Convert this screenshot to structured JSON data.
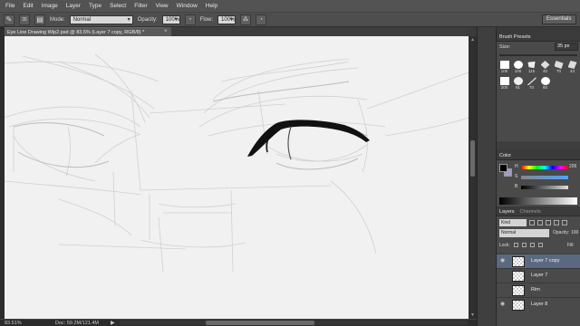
{
  "menubar": {
    "items": [
      "File",
      "Edit",
      "Image",
      "Layer",
      "Type",
      "Select",
      "Filter",
      "View",
      "Window",
      "Help"
    ]
  },
  "options": {
    "brush_size": "35",
    "mode_label": "Mode:",
    "mode_value": "Normal",
    "opacity_label": "Opacity:",
    "opacity_value": "100%",
    "flow_label": "Flow:",
    "flow_value": "100%",
    "workspace": "Essentials"
  },
  "document": {
    "tab_title": "Eye Line Drawing Wip2.psd @ 83.5% (Layer 7 copy, RGB/8) *",
    "close_glyph": "×"
  },
  "status": {
    "zoom": "83.51%",
    "doc_size": "Doc: 59.2M/121.4M",
    "arrow": "▶"
  },
  "brush_presets": {
    "tab": "Brush Presets",
    "size_label": "Size:",
    "size_value": "35 px",
    "tips": [
      {
        "num": "100",
        "color": "#ffffff"
      },
      {
        "num": "100",
        "color": "#ffffff"
      },
      {
        "num": "116",
        "color": "#eeeeee"
      },
      {
        "num": "40",
        "color": "#dddddd"
      },
      {
        "num": "70",
        "color": "#dddddd"
      },
      {
        "num": "44",
        "color": "#dddddd"
      },
      {
        "num": "200",
        "color": "#ffffff"
      },
      {
        "num": "91",
        "color": "#eeeeee"
      },
      {
        "num": "70",
        "color": "#dddddd"
      },
      {
        "num": "60",
        "color": "#ffffff"
      }
    ]
  },
  "color_panel": {
    "tab": "Color",
    "h_label": "H",
    "h_value": "206",
    "s_label": "S",
    "b_label": "B",
    "fg_color": "#000000",
    "bg_color": "#a39bc9"
  },
  "layers_panel": {
    "tabs": [
      "Layers",
      "Channels"
    ],
    "kind": "Kind",
    "blend_mode": "Normal",
    "opacity_label": "Opacity:",
    "opacity_value": "100",
    "lock_label": "Lock:",
    "fill_label": "Fill:",
    "fill_value": "100",
    "layers": [
      {
        "name": "Layer 7 copy",
        "visible": true,
        "active": true
      },
      {
        "name": "Layer 7",
        "visible": false,
        "active": false
      },
      {
        "name": "Rim",
        "visible": false,
        "active": false
      },
      {
        "name": "Layer 8",
        "visible": true,
        "active": false
      }
    ]
  }
}
